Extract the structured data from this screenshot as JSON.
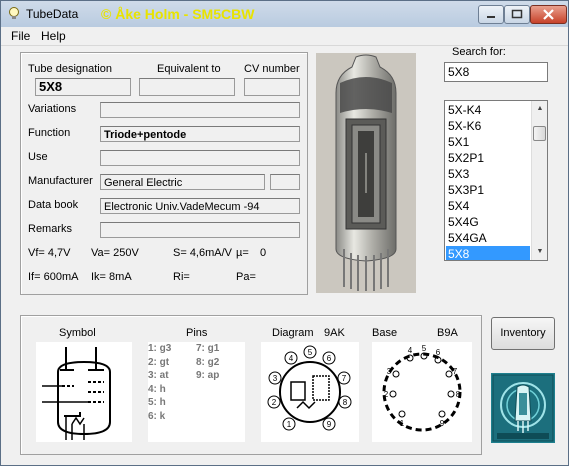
{
  "window": {
    "title": "TubeData",
    "author": "© Åke Holm - SM5CBW"
  },
  "menu": {
    "file": "File",
    "help": "Help"
  },
  "form": {
    "designation_label": "Tube designation",
    "equivalent_label": "Equivalent to",
    "cv_label": "CV number",
    "designation_value": "5X8",
    "equivalent_value": "",
    "cv_value": "",
    "variations_label": "Variations",
    "variations_value": "",
    "function_label": "Function",
    "function_value": "Triode+pentode",
    "use_label": "Use",
    "use_value": "",
    "manufacturer_label": "Manufacturer",
    "manufacturer_value": "General Electric",
    "manufacturer_extra": "",
    "databook_label": "Data book",
    "databook_value": "Electronic Univ.VadeMecum -94",
    "remarks_label": "Remarks",
    "remarks_value": "",
    "vf": "Vf= 4,7V",
    "va": "Va=  250V",
    "s": "S= 4,6mA/V",
    "mu": "µ=",
    "mu_value": "0",
    "if": "If= 600mA",
    "ik": "Ik=  8mA",
    "ri": "Ri=",
    "pa": "Pa="
  },
  "search": {
    "label": "Search for:",
    "value": "5X8"
  },
  "tube_list": [
    "5X-K4",
    "5X-K6",
    "5X1",
    "5X2P1",
    "5X3",
    "5X3P1",
    "5X4",
    "5X4G",
    "5X4GA",
    "5X8"
  ],
  "selected_tube": "5X8",
  "bottom": {
    "symbol_label": "Symbol",
    "pins_label": "Pins",
    "diagram_label": "Diagram",
    "diagram_code": "9AK",
    "base_label": "Base",
    "base_code": "B9A",
    "pins_col1": [
      "1: g3",
      "2: gt",
      "3: at",
      "4: h",
      "5: h",
      "6: k"
    ],
    "pins_col2": [
      "7: g1",
      "8: g2",
      "9: ap"
    ]
  },
  "inventory_button": "Inventory",
  "icons": [
    "lightbulb-icon",
    "minimize-icon",
    "maximize-icon",
    "close-icon",
    "scroll-up-icon",
    "scroll-down-icon"
  ]
}
